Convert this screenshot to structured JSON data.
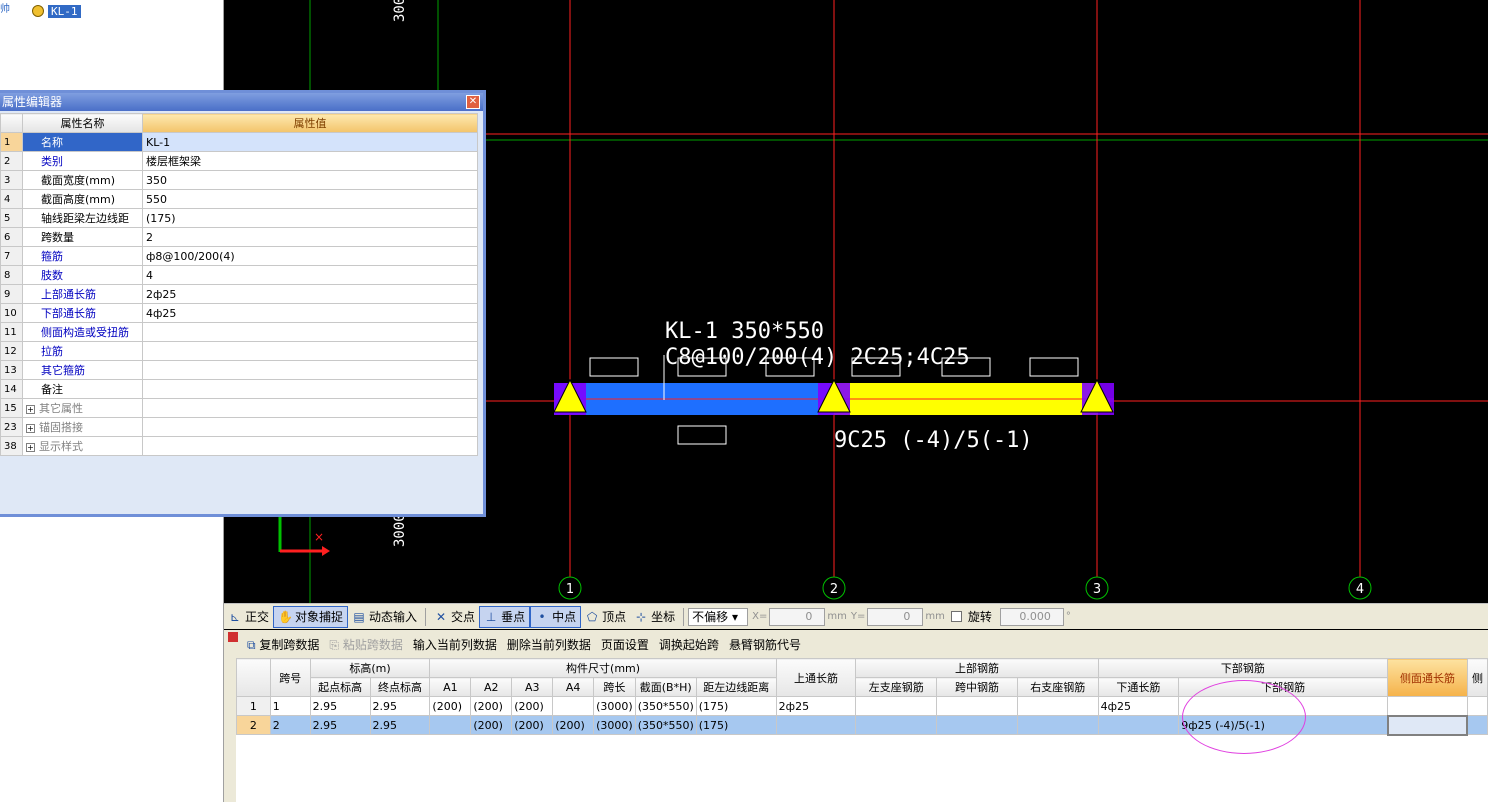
{
  "tree": {
    "node_label": "KL-1",
    "trunk_text": "帅"
  },
  "canvas": {
    "dim_text_top": "3000",
    "dim_text_bottom": "3000",
    "beam_label_line1": "KL-1 350*550",
    "beam_label_line2": "C8@100/200(4) 2C25;4C25",
    "beam_label_bottom": "9C25 (-4)/5(-1)",
    "axis_labels": [
      "1",
      "2",
      "3",
      "4"
    ],
    "colors": {
      "left_span": "#1e6fff",
      "right_span": "#ffff00",
      "grid_red": "#ff2020",
      "grid_green": "#00a000",
      "support": "#8000ff"
    }
  },
  "prop_editor": {
    "title": "属性编辑器",
    "col_name": "属性名称",
    "col_value": "属性值",
    "rows": [
      {
        "num": "1",
        "name": "名称",
        "value": "KL-1",
        "style": "sel"
      },
      {
        "num": "2",
        "name": "类别",
        "value": "楼层框架梁",
        "style": "blue"
      },
      {
        "num": "3",
        "name": "截面宽度(mm)",
        "value": "350",
        "style": ""
      },
      {
        "num": "4",
        "name": "截面高度(mm)",
        "value": "550",
        "style": ""
      },
      {
        "num": "5",
        "name": "轴线距梁左边线距",
        "value": "(175)",
        "style": ""
      },
      {
        "num": "6",
        "name": "跨数量",
        "value": "2",
        "style": ""
      },
      {
        "num": "7",
        "name": "箍筋",
        "value": "ф8@100/200(4)",
        "style": "blue"
      },
      {
        "num": "8",
        "name": "肢数",
        "value": "4",
        "style": "blue"
      },
      {
        "num": "9",
        "name": "上部通长筋",
        "value": "2ф25",
        "style": "blue"
      },
      {
        "num": "10",
        "name": "下部通长筋",
        "value": "4ф25",
        "style": "blue"
      },
      {
        "num": "11",
        "name": "侧面构造或受扭筋",
        "value": "",
        "style": "blue"
      },
      {
        "num": "12",
        "name": "拉筋",
        "value": "",
        "style": "blue"
      },
      {
        "num": "13",
        "name": "其它箍筋",
        "value": "",
        "style": "blue"
      },
      {
        "num": "14",
        "name": "备注",
        "value": "",
        "style": ""
      },
      {
        "num": "15",
        "name": "其它属性",
        "value": "",
        "style": "group"
      },
      {
        "num": "23",
        "name": "锚固搭接",
        "value": "",
        "style": "group"
      },
      {
        "num": "38",
        "name": "显示样式",
        "value": "",
        "style": "group"
      }
    ]
  },
  "toolbar": {
    "ortho": "正交",
    "snap": "对象捕捉",
    "dyn_input": "动态输入",
    "intersect": "交点",
    "perp": "垂点",
    "mid": "中点",
    "vertex": "顶点",
    "coord": "坐标",
    "offset_mode": "不偏移",
    "x_label": "X=",
    "x_value": "0",
    "y_label": "Y=",
    "y_value": "0",
    "unit": "mm",
    "rotate_label": "旋转",
    "rotate_value": "0.000",
    "deg": "°"
  },
  "toolbar2": {
    "copy_span": "复制跨数据",
    "paste_span": "粘贴跨数据",
    "input_col": "输入当前列数据",
    "delete_col": "删除当前列数据",
    "page_setup": "页面设置",
    "swap_start": "调换起始跨",
    "cantilever": "悬臂钢筋代号"
  },
  "grid": {
    "h_span": "跨号",
    "h_elev": "标高(m)",
    "h_size": "构件尺寸(mm)",
    "h_top_long": "上通长筋",
    "h_top_bars": "上部钢筋",
    "h_bot_bars": "下部钢筋",
    "h_start": "起点标高",
    "h_end": "终点标高",
    "h_a1": "A1",
    "h_a2": "A2",
    "h_a3": "A3",
    "h_a4": "A4",
    "h_len": "跨长",
    "h_section": "截面(B*H)",
    "h_dist": "距左边线距离",
    "h_left_sup": "左支座钢筋",
    "h_mid": "跨中钢筋",
    "h_right_sup": "右支座钢筋",
    "h_bot_long": "下通长筋",
    "h_bot": "下部钢筋",
    "h_side": "侧面通长筋",
    "rows": [
      {
        "rn": "1",
        "span": "1",
        "start": "2.95",
        "end": "2.95",
        "a1": "(200)",
        "a2": "(200)",
        "a3": "(200)",
        "a4": "",
        "len": "(3000)",
        "sec": "(350*550)",
        "dist": "(175)",
        "top_long": "2ф25",
        "left_sup": "",
        "mid": "",
        "right_sup": "",
        "bot_long": "4ф25",
        "bot": "",
        "side": ""
      },
      {
        "rn": "2",
        "span": "2",
        "start": "2.95",
        "end": "2.95",
        "a1": "",
        "a2": "(200)",
        "a3": "(200)",
        "a4": "(200)",
        "len": "(3000)",
        "sec": "(350*550)",
        "dist": "(175)",
        "top_long": "",
        "left_sup": "",
        "mid": "",
        "right_sup": "",
        "bot_long": "",
        "bot": "9ф25 (-4)/5(-1)",
        "side": ""
      }
    ]
  }
}
